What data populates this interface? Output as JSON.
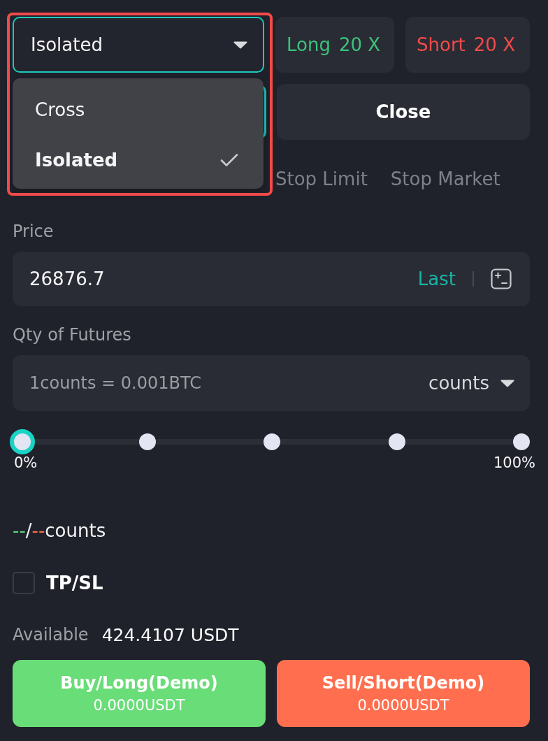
{
  "margin_mode": {
    "value": "Isolated",
    "expanded": true,
    "highlighted": true,
    "options": [
      {
        "label": "Cross",
        "selected": false
      },
      {
        "label": "Isolated",
        "selected": true
      }
    ]
  },
  "leverage": [
    {
      "kind": "long",
      "label": "Long",
      "value": "20 X"
    },
    {
      "kind": "short",
      "label": "Short",
      "value": "20 X"
    }
  ],
  "side_tabs": [
    {
      "selected": true
    },
    {
      "label": "Close",
      "selected": false
    }
  ],
  "order_types": [
    {
      "label": "Stop Limit",
      "selected": false
    },
    {
      "label": "Stop Market",
      "selected": false
    }
  ],
  "price": {
    "label": "Price",
    "value": "26876.7",
    "reference": "Last"
  },
  "quantity": {
    "label": "Qty of Futures",
    "placeholder": "1counts = 0.001BTC",
    "unit": "counts"
  },
  "slider": {
    "level": 0,
    "min_label": "0%",
    "max_label": "100%"
  },
  "max_quantity": [
    {
      "kind": "long",
      "text": "--"
    },
    {
      "kind": "plain",
      "text": "/"
    },
    {
      "kind": "short",
      "text": "--"
    },
    {
      "kind": "plain",
      "text": "counts"
    }
  ],
  "tp_sl": {
    "label": "TP/SL",
    "checked": false
  },
  "available": {
    "label": "Available",
    "value": "424.4107 USDT"
  },
  "actions": [
    {
      "kind": "buy",
      "title": "Buy/Long(Demo)",
      "amount": "0.0000USDT"
    },
    {
      "kind": "sell",
      "title": "Sell/Short(Demo)",
      "amount": "0.0000USDT"
    }
  ]
}
